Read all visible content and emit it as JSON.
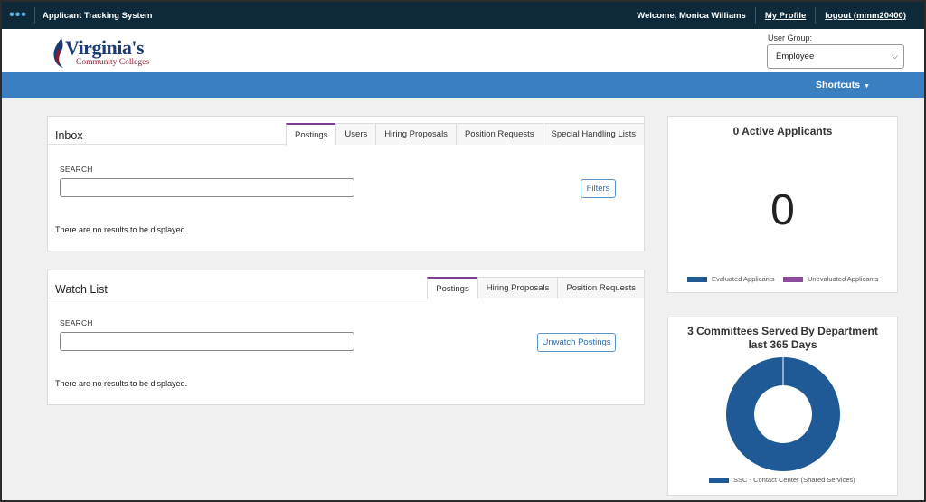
{
  "topbar": {
    "app_title": "Applicant Tracking System",
    "welcome": "Welcome, Monica Williams",
    "my_profile": "My Profile",
    "logout": "logout (mmm20400)"
  },
  "header": {
    "logo_name": "Virginia's",
    "logo_sub": "Community Colleges",
    "user_group_label": "User Group:",
    "user_group_value": "Employee"
  },
  "shortcuts": {
    "label": "Shortcuts"
  },
  "inbox": {
    "title": "Inbox",
    "tabs": [
      "Postings",
      "Users",
      "Hiring Proposals",
      "Position Requests",
      "Special Handling Lists"
    ],
    "active_tab": "Postings",
    "search_label": "SEARCH",
    "filters_button": "Filters",
    "no_results": "There are no results to be displayed."
  },
  "watchlist": {
    "title": "Watch List",
    "tabs": [
      "Postings",
      "Hiring Proposals",
      "Position Requests"
    ],
    "active_tab": "Postings",
    "search_label": "SEARCH",
    "unwatch_button": "Unwatch Postings",
    "no_results": "There are no results to be displayed."
  },
  "active_applicants": {
    "title": "0 Active Applicants",
    "count": "0",
    "legend": [
      {
        "label": "Evaluated Applicants",
        "color": "#1f5a96"
      },
      {
        "label": "Unevaluated Applicants",
        "color": "#8e4a9c"
      }
    ]
  },
  "committees": {
    "title": "3 Committees Served By Department last 365 Days",
    "legend": [
      {
        "label": "SSC - Contact Center (Shared Services)",
        "color": "#1f5a96"
      }
    ],
    "chart_data": {
      "type": "pie",
      "categories": [
        "SSC - Contact Center (Shared Services)"
      ],
      "values": [
        3
      ]
    }
  },
  "colors": {
    "topbar": "#0e2a3a",
    "shortcut_bar": "#3a7fc1",
    "active_tab_accent": "#7b3f98",
    "donut": "#1f5a96"
  }
}
